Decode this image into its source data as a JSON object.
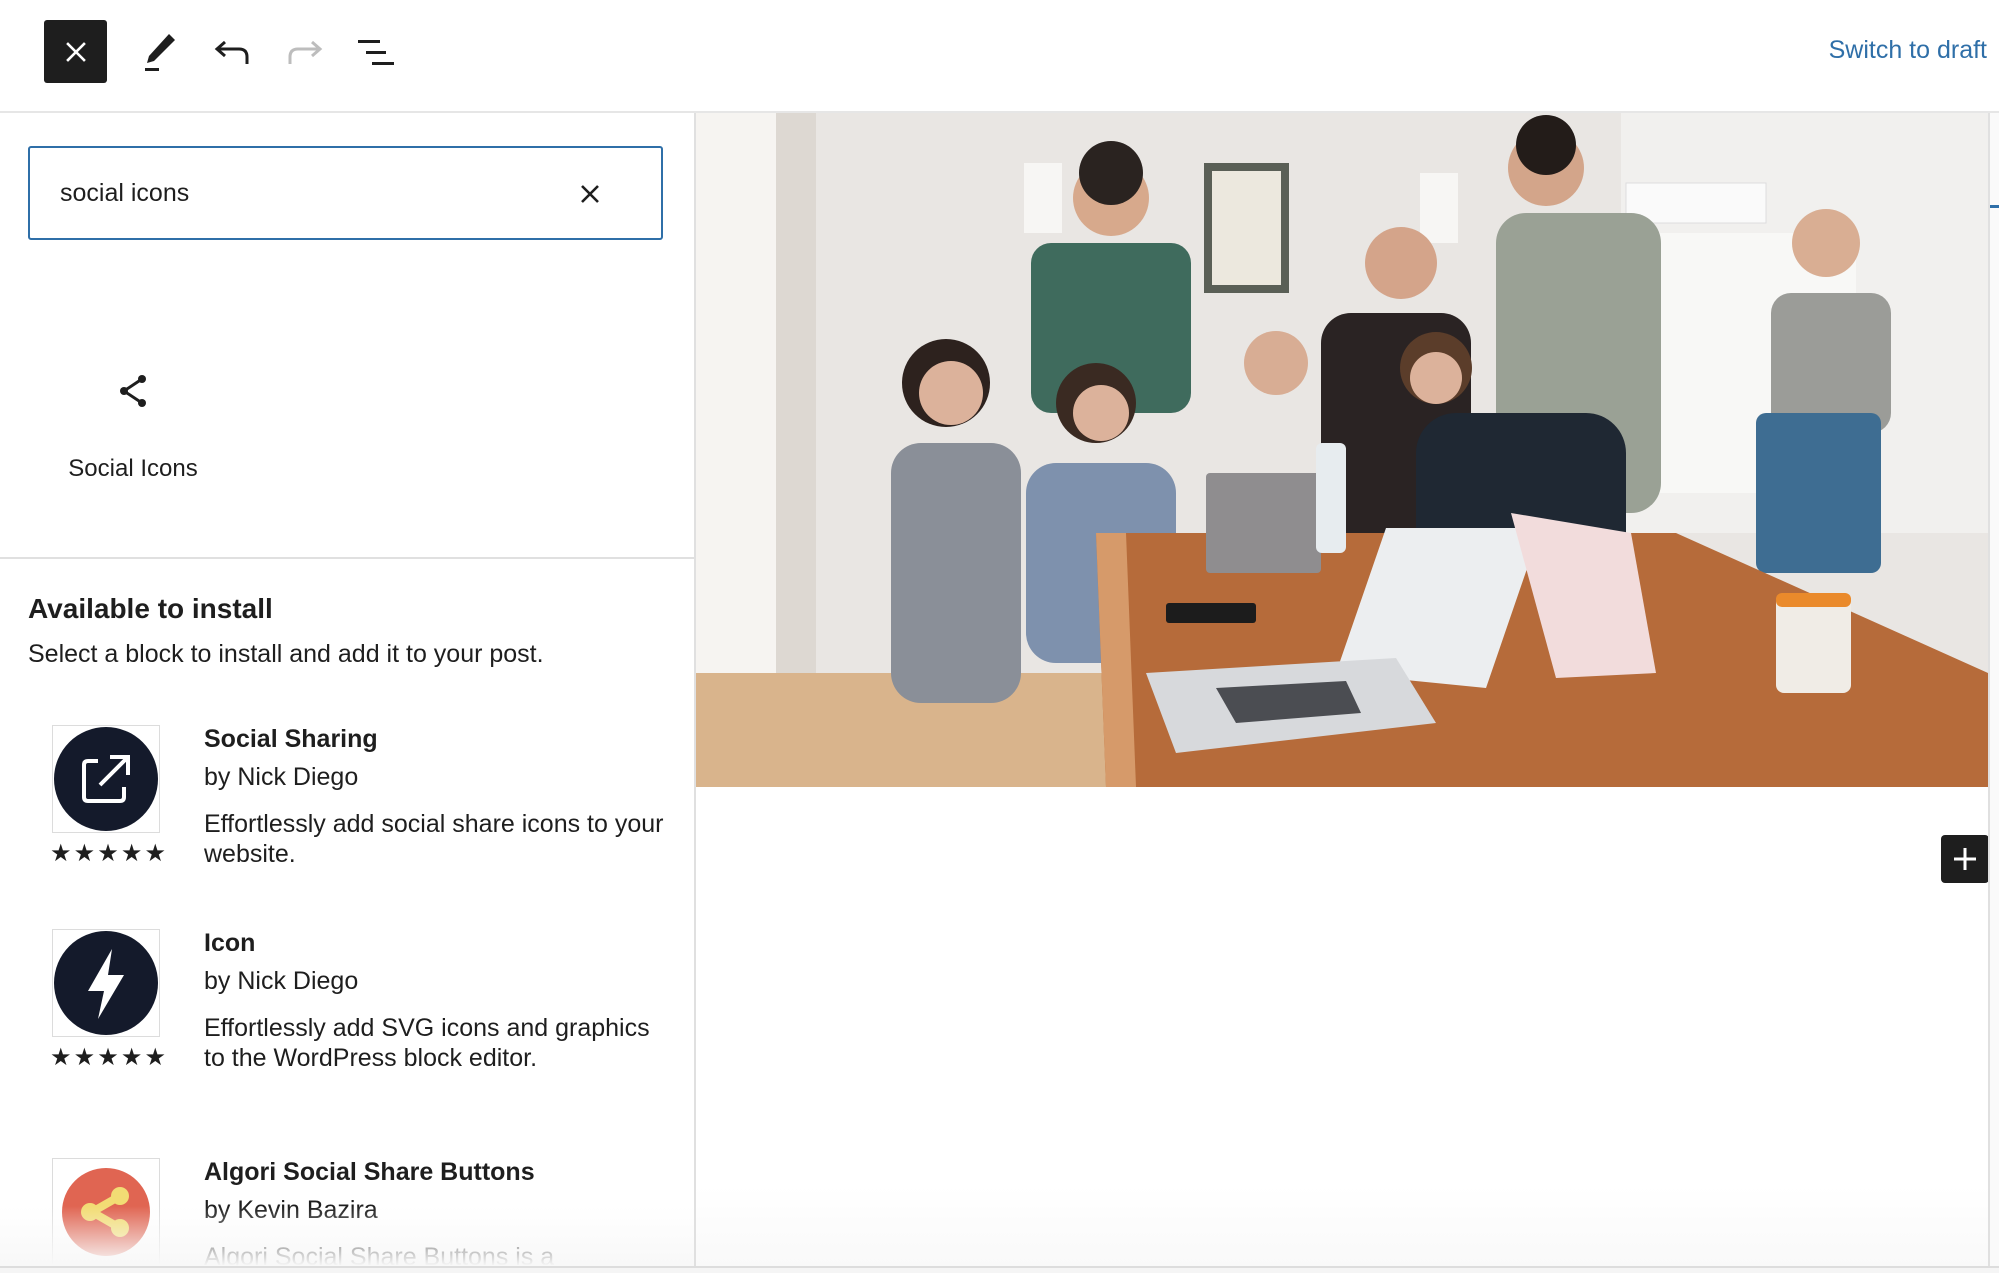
{
  "header": {
    "close_icon": "close-icon",
    "tools_icon": "pencil-icon",
    "undo_icon": "undo-icon",
    "redo_icon": "redo-icon",
    "list_view_icon": "list-view-icon",
    "switch_to_draft": "Switch to draft"
  },
  "inserter": {
    "search": {
      "value": "social icons",
      "clear_icon": "close-icon"
    },
    "results": [
      {
        "label": "Social Icons",
        "icon": "share-icon"
      }
    ],
    "available": {
      "title": "Available to install",
      "subtitle": "Select a block to install and add it to your post.",
      "plugins": [
        {
          "name": "Social Sharing",
          "author": "by Nick Diego",
          "description": "Effortlessly add social share icons to your website.",
          "rating": 5,
          "icon": "external-share-icon",
          "icon_bg": "#141a2b"
        },
        {
          "name": "Icon",
          "author": "by Nick Diego",
          "description": "Effortlessly add SVG icons and graphics to the WordPress block editor.",
          "rating": 5,
          "icon": "lightning-icon",
          "icon_bg": "#141a2b"
        },
        {
          "name": "Algori Social Share Buttons",
          "author": "by Kevin Bazira",
          "description": "Algori Social Share Buttons is a",
          "icon": "share-icon",
          "icon_bg": "#e06552",
          "icon_fg": "#f2dc74"
        }
      ]
    }
  },
  "canvas": {
    "image_alt": "group of people gathered around a table with laptops",
    "add_block_icon": "plus-icon"
  },
  "colors": {
    "accent": "#2f6fa8",
    "dark": "#1e1e1e"
  }
}
